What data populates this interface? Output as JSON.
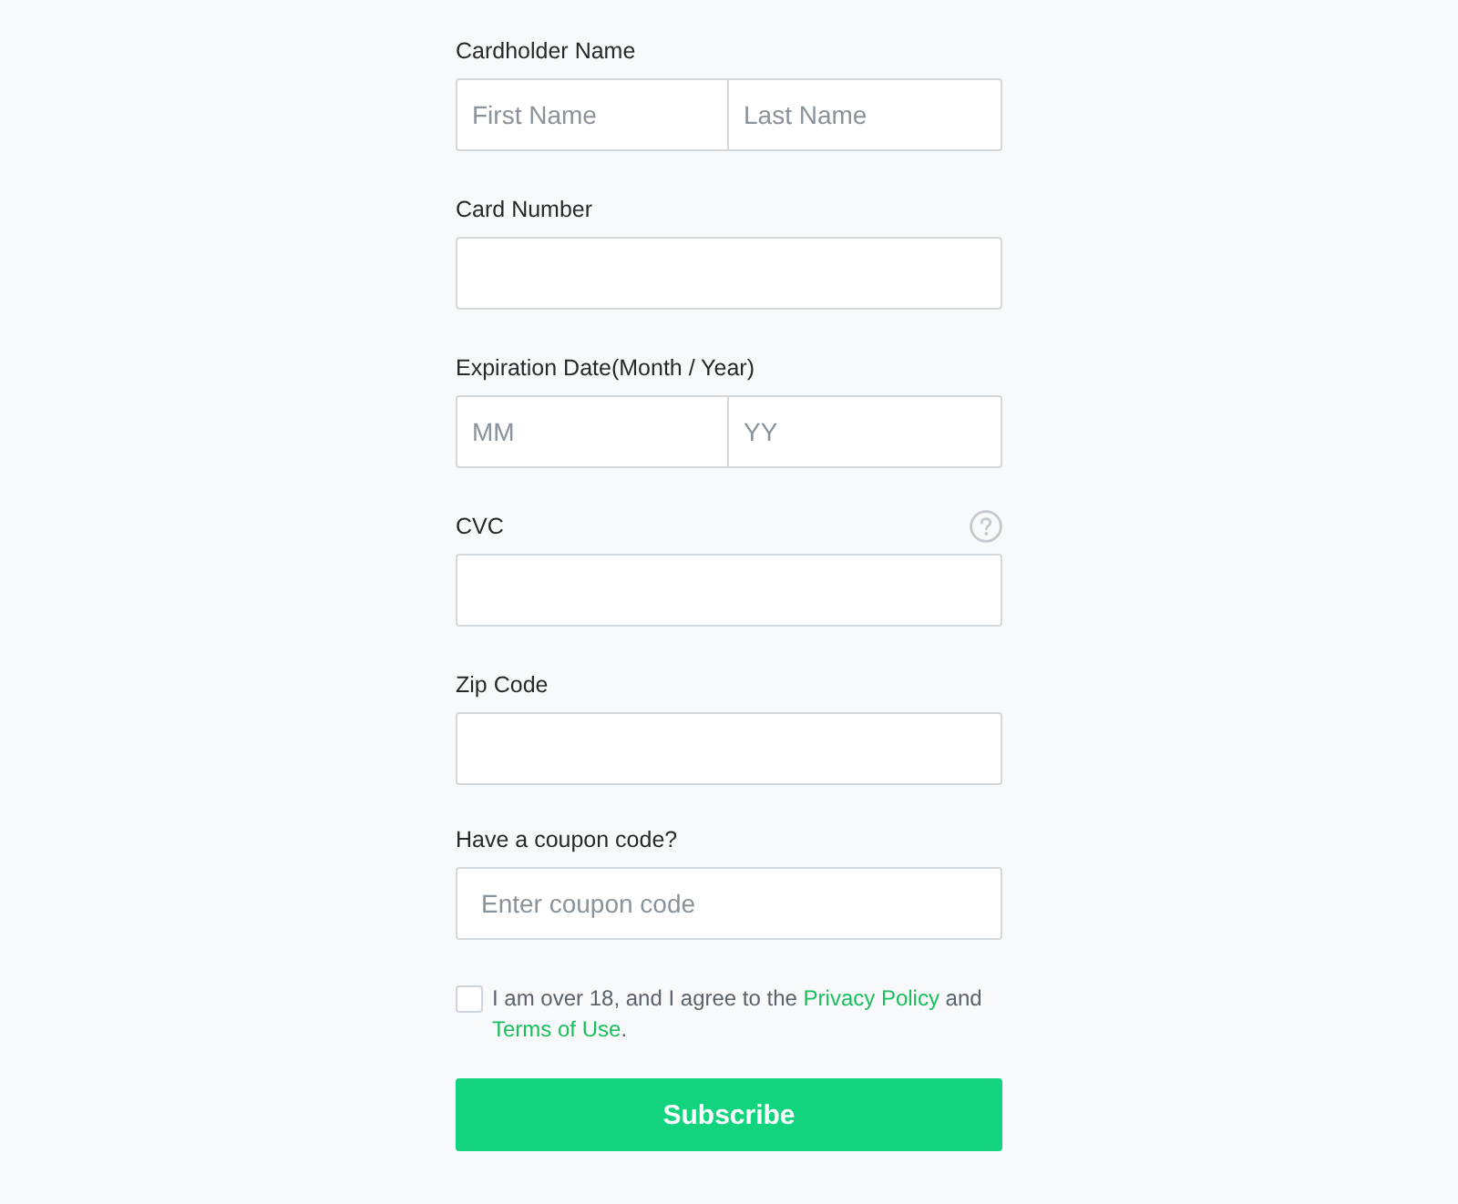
{
  "form": {
    "fields": [
      {
        "label": "Cardholder Name",
        "kind": "split",
        "help": false,
        "placeholders": [
          "First Name",
          "Last Name"
        ]
      },
      {
        "label": "Card Number",
        "kind": "single",
        "help": false
      },
      {
        "label": "Expiration Date(Month / Year)",
        "kind": "split",
        "help": false,
        "placeholders": [
          "MM",
          "YY"
        ]
      },
      {
        "label": "CVC",
        "kind": "single",
        "help": true
      },
      {
        "label": "Zip Code",
        "kind": "single",
        "help": false
      },
      {
        "label": "Have a coupon code?",
        "kind": "single",
        "help": false,
        "placeholders": [
          "Enter coupon code"
        ]
      }
    ],
    "agreement": {
      "checked": false,
      "parts": [
        {
          "kind": "text",
          "text": "I am over 18, and I agree to the "
        },
        {
          "kind": "link",
          "text": "Privacy Policy"
        },
        {
          "kind": "text",
          "text": " and "
        },
        {
          "kind": "link",
          "text": "Terms of Use"
        },
        {
          "kind": "text",
          "text": "."
        }
      ]
    },
    "submit": {
      "label": "Subscribe"
    }
  }
}
